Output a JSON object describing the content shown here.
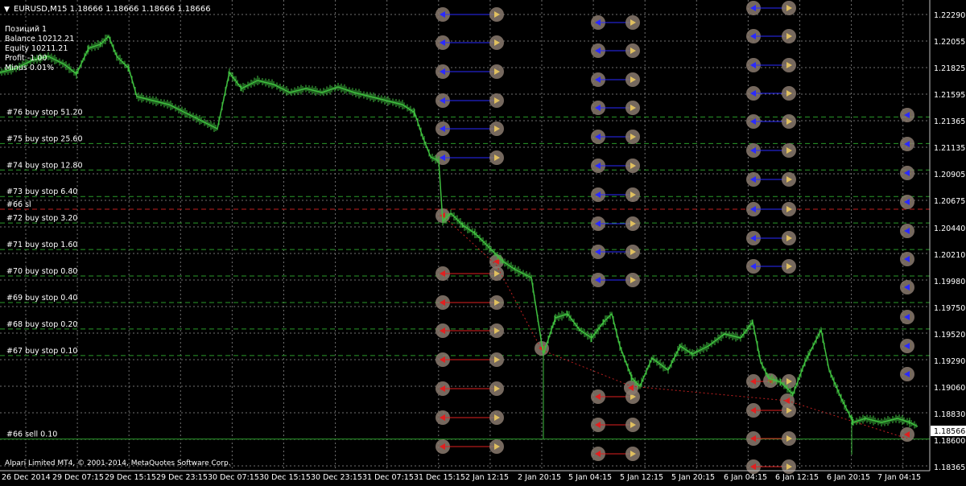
{
  "header": {
    "symbol_line": "EURUSD,M15  1.18666 1.18666 1.18666 1.18666"
  },
  "info_panel": [
    "Позиций  1",
    "Balance  10212.21",
    "Equity  10211.21",
    "Profit  -1.00",
    "Minus  0.01%"
  ],
  "price_axis": {
    "labels": [
      "1.22290",
      "1.22055",
      "1.21825",
      "1.21595",
      "1.21365",
      "1.21135",
      "1.20905",
      "1.20675",
      "1.20440",
      "1.20210",
      "1.19980",
      "1.19750",
      "1.19520",
      "1.19290",
      "1.19060",
      "1.18830",
      "1.18600",
      "1.18365"
    ],
    "current_price": "1.18566"
  },
  "time_axis": {
    "labels": [
      "26 Dec 2014",
      "29 Dec 07:15",
      "29 Dec 15:15",
      "29 Dec 23:15",
      "30 Dec 07:15",
      "30 Dec 15:15",
      "30 Dec 23:15",
      "31 Dec 07:15",
      "31 Dec 15:15",
      "2 Jan 12:15",
      "2 Jan 20:15",
      "5 Jan 04:15",
      "5 Jan 12:15",
      "5 Jan 20:15",
      "6 Jan 04:15",
      "6 Jan 12:15",
      "6 Jan 20:15",
      "7 Jan 04:15"
    ]
  },
  "order_levels": [
    {
      "label": "#76 buy stop 51.20",
      "price": 1.214,
      "color": "#2a9a2a",
      "style": "dashed"
    },
    {
      "label": "#75 buy stop 25.60",
      "price": 1.2117,
      "color": "#2a9a2a",
      "style": "dashed"
    },
    {
      "label": "#74 buy stop 12.80",
      "price": 1.2094,
      "color": "#2a9a2a",
      "style": "dashed"
    },
    {
      "label": "#73 buy stop 6.40",
      "price": 1.2071,
      "color": "#2a9a2a",
      "style": "dashed"
    },
    {
      "label": "#66 sl",
      "price": 1.206,
      "color": "#c02020",
      "style": "dashed"
    },
    {
      "label": "#72 buy stop 3.20",
      "price": 1.2048,
      "color": "#2a9a2a",
      "style": "dashed"
    },
    {
      "label": "#71 buy stop 1.60",
      "price": 1.2025,
      "color": "#2a9a2a",
      "style": "dashed"
    },
    {
      "label": "#70 buy stop 0.80",
      "price": 1.2002,
      "color": "#2a9a2a",
      "style": "dashed"
    },
    {
      "label": "#69 buy stop 0.40",
      "price": 1.1979,
      "color": "#2a9a2a",
      "style": "dashed"
    },
    {
      "label": "#68 buy stop 0.20",
      "price": 1.1956,
      "color": "#2a9a2a",
      "style": "dashed"
    },
    {
      "label": "#67 buy stop 0.10",
      "price": 1.1933,
      "color": "#2a9a2a",
      "style": "dashed"
    },
    {
      "label": "#66 sell 0.10",
      "price": 1.18605,
      "color": "#2a9a2a",
      "style": "solid"
    }
  ],
  "footer": {
    "copyright": "Alpari Limited MT4, © 2001-2014, MetaQuotes Software Corp."
  },
  "colors": {
    "background": "#000000",
    "grid": "#6f6f6f",
    "text": "#ffffff",
    "candles": "#3fbf3f",
    "buy_arrow": "#2a2aff",
    "sell_arrow": "#e02020",
    "marker_circle": "#8a7a6e"
  }
}
